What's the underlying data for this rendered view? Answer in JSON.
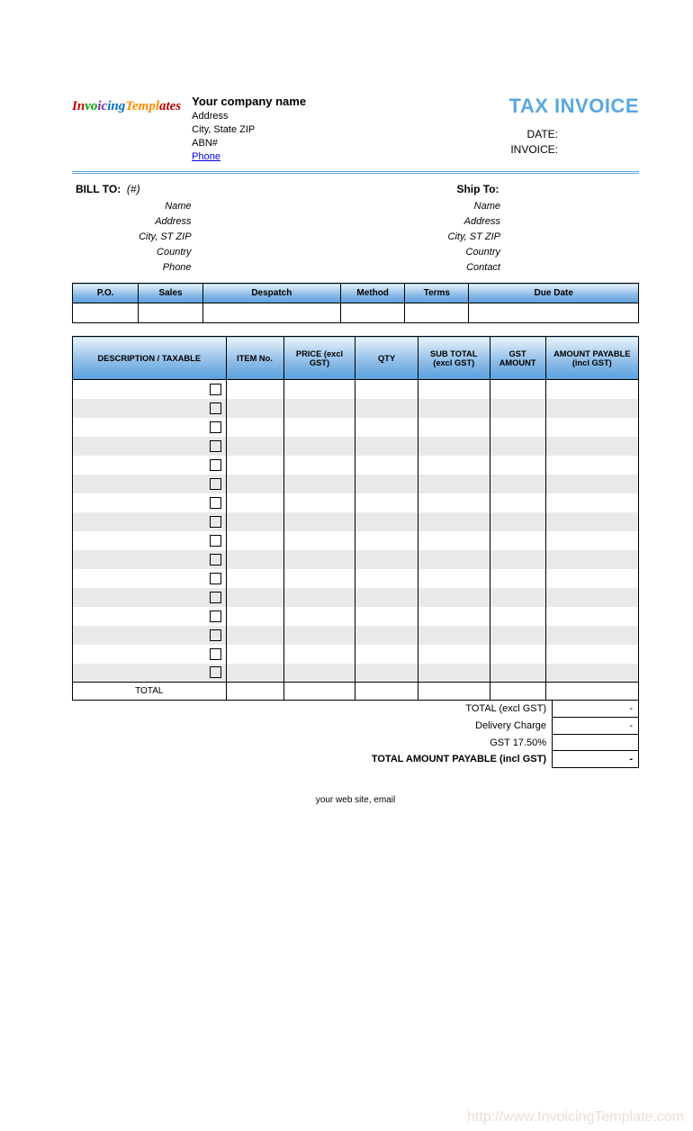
{
  "logo_text": "InvoicingTemplates",
  "company": {
    "name": "Your company name",
    "address": "Address",
    "city_state_zip": "City, State ZIP",
    "abn": "ABN#",
    "phone": "Phone"
  },
  "title": "TAX INVOICE",
  "meta": {
    "date_label": "DATE:",
    "invoice_label": "INVOICE:"
  },
  "bill_to": {
    "heading": "BILL TO:",
    "hash": "(#)",
    "name": "Name",
    "address": "Address",
    "city": "City, ST ZIP",
    "country": "Country",
    "phone": "Phone"
  },
  "ship_to": {
    "heading": "Ship To:",
    "name": "Name",
    "address": "Address",
    "city": "City, ST ZIP",
    "country": "Country",
    "contact": "Contact"
  },
  "meta_cols": {
    "po": "P.O.",
    "sales": "Sales",
    "despatch": "Despatch",
    "method": "Method",
    "terms": "Terms",
    "due": "Due Date"
  },
  "item_cols": {
    "desc": "DESCRIPTION / TAXABLE",
    "item": "ITEM No.",
    "price": "PRICE (excl GST)",
    "qty": "QTY",
    "sub": "SUB TOTAL (excl GST)",
    "gst": "GST AMOUNT",
    "amt": "AMOUNT PAYABLE (incl GST)"
  },
  "total_label": "TOTAL",
  "summary": {
    "total_excl": {
      "label": "TOTAL (excl GST)",
      "value": "-"
    },
    "delivery": {
      "label": "Delivery Charge",
      "value": "-"
    },
    "gst_rate": {
      "label": "GST 17.50%",
      "value": ""
    },
    "total_payable": {
      "label": "TOTAL AMOUNT PAYABLE (incl GST)",
      "value": "-"
    }
  },
  "footer": "your web site, email",
  "watermark": "http://www.InvoicingTemplate.com"
}
